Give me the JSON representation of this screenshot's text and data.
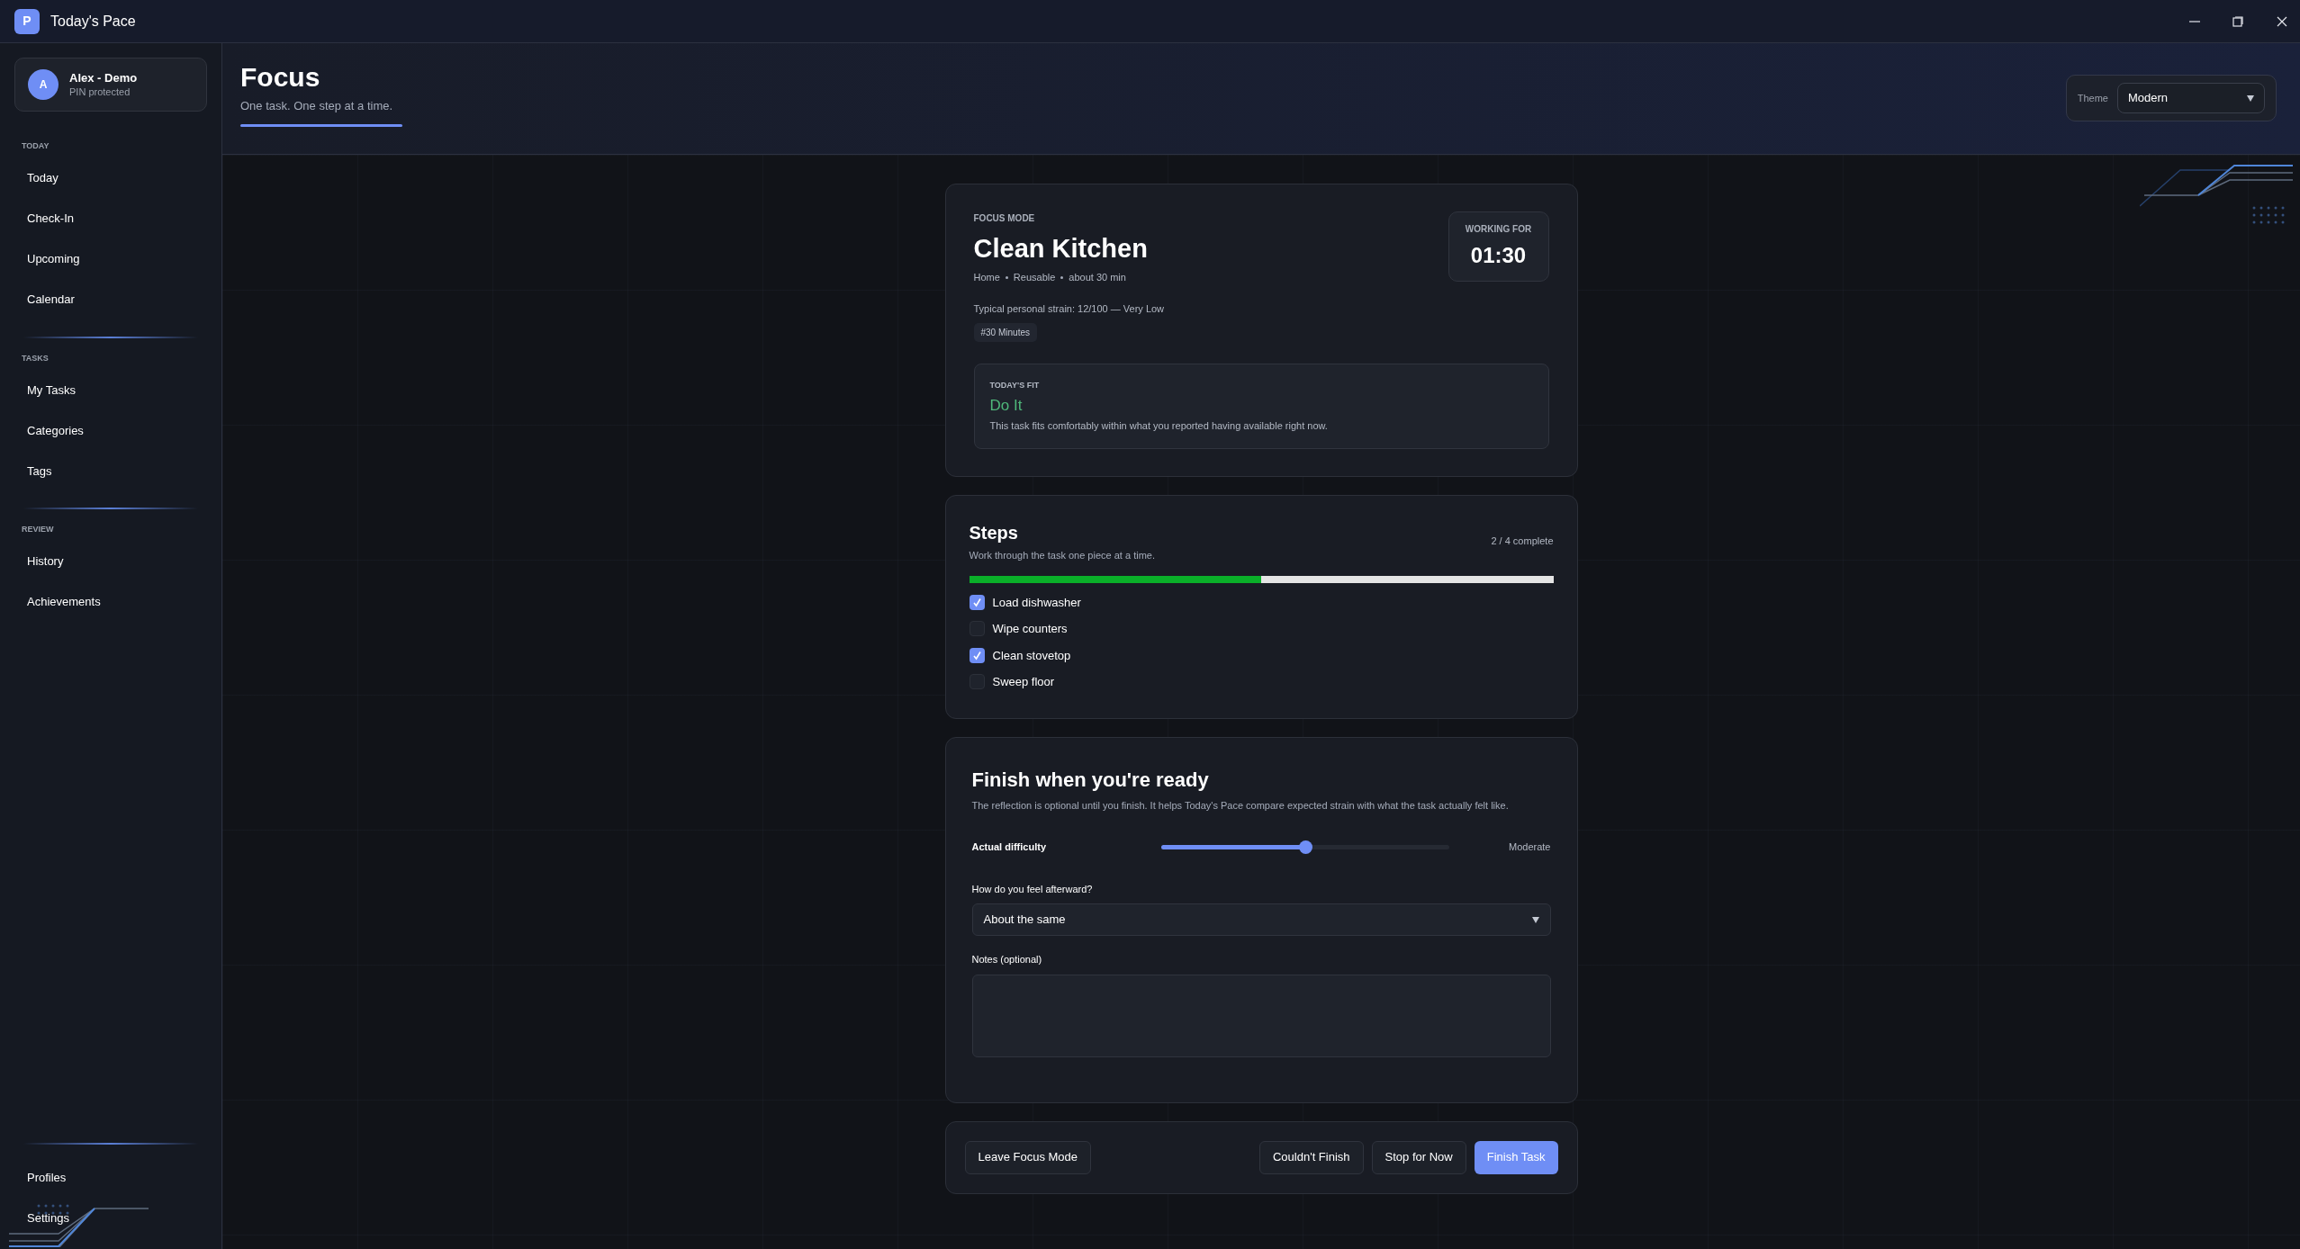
{
  "window": {
    "title": "Today's Pace",
    "logo_letter": "P"
  },
  "profile": {
    "initial": "A",
    "name": "Alex - Demo",
    "subtitle": "PIN protected"
  },
  "sidebar": {
    "sections": [
      {
        "heading": "TODAY",
        "items": [
          "Today",
          "Check-In",
          "Upcoming",
          "Calendar"
        ]
      },
      {
        "heading": "TASKS",
        "items": [
          "My Tasks",
          "Categories",
          "Tags"
        ]
      },
      {
        "heading": "REVIEW",
        "items": [
          "History",
          "Achievements"
        ]
      }
    ],
    "footer_items": [
      "Profiles",
      "Settings"
    ]
  },
  "header": {
    "title": "Focus",
    "subtitle": "One task. One step at a time.",
    "theme_label": "Theme",
    "theme_value": "Modern"
  },
  "focus_card": {
    "eyebrow": "FOCUS MODE",
    "task": "Clean Kitchen",
    "meta": [
      "Home",
      "Reusable",
      "about 30 min"
    ],
    "strain": "Typical personal strain: 12/100 — Very Low",
    "tags": [
      "#30 Minutes"
    ],
    "timer_label": "WORKING FOR",
    "timer": "01:30",
    "fit": {
      "label": "TODAY'S FIT",
      "verdict": "Do It",
      "color": "#4fb87a",
      "description": "This task fits comfortably within what you reported having available right now."
    }
  },
  "steps": {
    "title": "Steps",
    "subtitle": "Work through the task one piece at a time.",
    "progress_text": "2 / 4 complete",
    "level": 0.5,
    "items": [
      {
        "label": "Load dishwasher",
        "checked": true
      },
      {
        "label": "Wipe counters",
        "checked": false
      },
      {
        "label": "Clean stovetop",
        "checked": true
      },
      {
        "label": "Sweep floor",
        "checked": false
      }
    ]
  },
  "finish": {
    "title": "Finish when you're ready",
    "description": "The reflection is optional until you finish. It helps Today's Pace compare expected strain with what the task actually felt like.",
    "difficulty": {
      "label": "Actual difficulty",
      "level": 0.5,
      "reading": "Moderate"
    },
    "feeling": {
      "label": "How do you feel afterward?",
      "value": "About the same"
    },
    "notes": {
      "label": "Notes (optional)"
    }
  },
  "actions": [
    {
      "label": "Leave Focus Mode",
      "kind": "secondary"
    },
    {
      "label": "Couldn't Finish",
      "kind": "secondary"
    },
    {
      "label": "Stop for Now",
      "kind": "secondary"
    },
    {
      "label": "Finish Task",
      "kind": "primary"
    }
  ]
}
